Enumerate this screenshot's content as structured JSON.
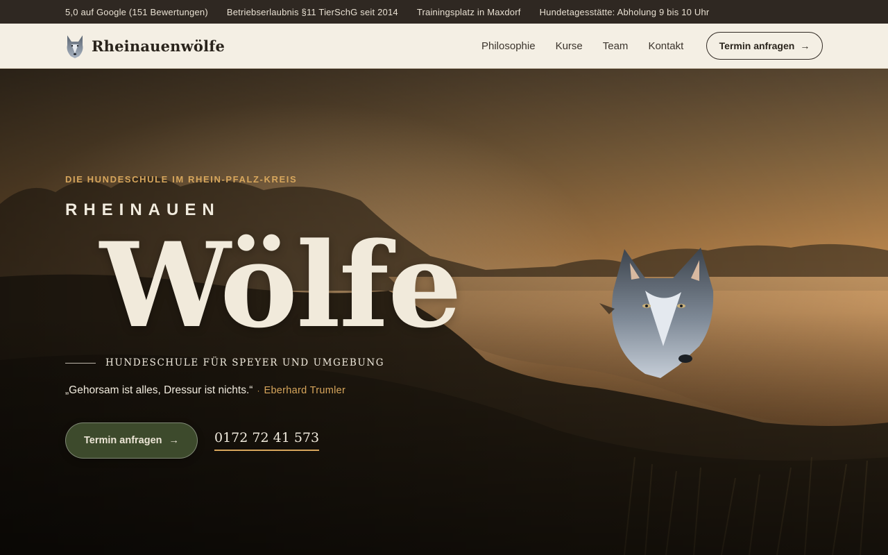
{
  "topbar": {
    "items": [
      "5,0 auf Google (151 Bewertungen)",
      "Betriebserlaubnis §11 TierSchG seit 2014",
      "Trainingsplatz in Maxdorf",
      "Hundetagesstätte: Abholung 9 bis 10 Uhr"
    ]
  },
  "header": {
    "logo_text": "Rheinauenwölfe",
    "nav": [
      "Philosophie",
      "Kurse",
      "Team",
      "Kontakt"
    ],
    "cta_label": "Termin anfragen",
    "cta_icon": "arrow-right-icon"
  },
  "hero": {
    "eyebrow": "DIE HUNDESCHULE IM RHEIN-PFALZ-KREIS",
    "kicker": "RHEINAUEN",
    "title": "Wölfe",
    "subline": "HUNDESCHULE FÜR SPEYER UND UMGEBUNG",
    "quote": "„Gehorsam ist alles, Dressur ist nichts.“",
    "quote_separator": "·",
    "quote_author": "Eberhard Trumler",
    "cta_label": "Termin anfragen",
    "cta_icon": "arrow-right-icon",
    "phone": "0172 72 41 573"
  },
  "colors": {
    "accent_gold": "#d7a65c",
    "header_bg": "#f4efe4",
    "topbar_bg": "#2f2822",
    "cta_green": "#3d4a2c"
  }
}
